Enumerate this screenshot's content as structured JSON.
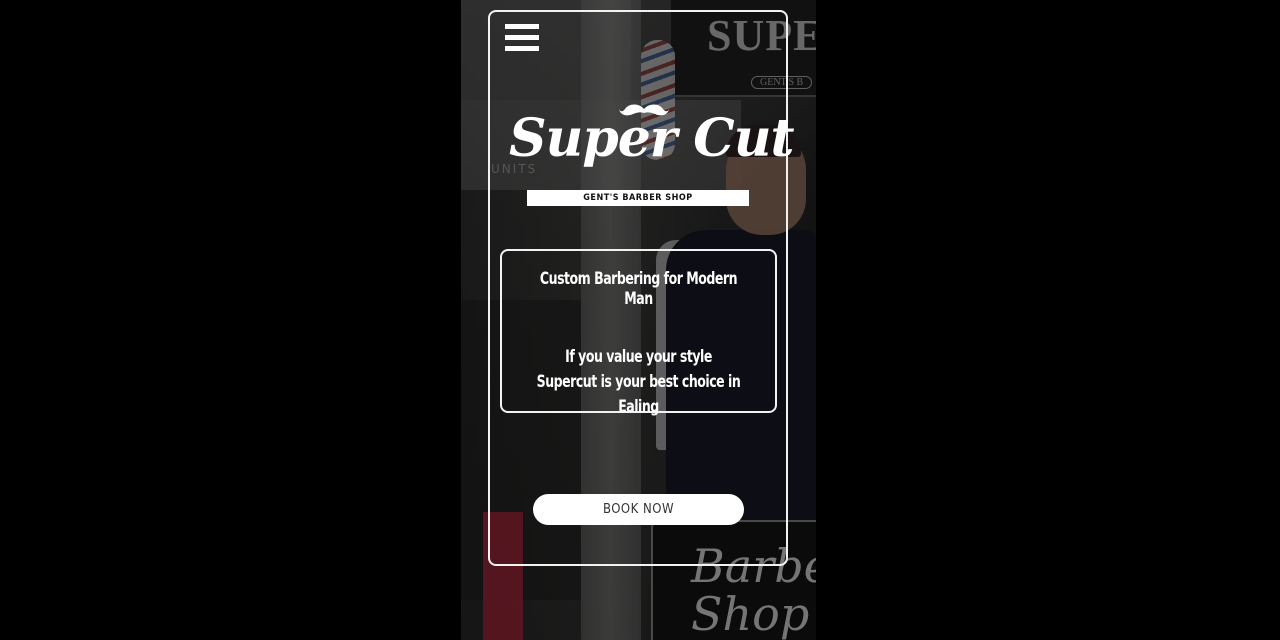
{
  "menu": {
    "icon": "hamburger-menu-icon"
  },
  "logo": {
    "name": "Super Cut",
    "subtitle": "GENT'S BARBER SHOP",
    "icon": "mustache-icon"
  },
  "hero": {
    "heading": "Custom Barbering for Modern Man",
    "line1": "If you value your style",
    "line2": "Supercut is your best choice in Ealing"
  },
  "cta": {
    "book_label": "BOOK NOW"
  },
  "background": {
    "sign_text": "SUPE",
    "sign_subtext": "GENT'S B",
    "units_text": "UNITS",
    "board_text": "Barbe Shop"
  },
  "colors": {
    "page_background": "#000000",
    "foreground": "#ffffff",
    "button_text": "#333333"
  }
}
